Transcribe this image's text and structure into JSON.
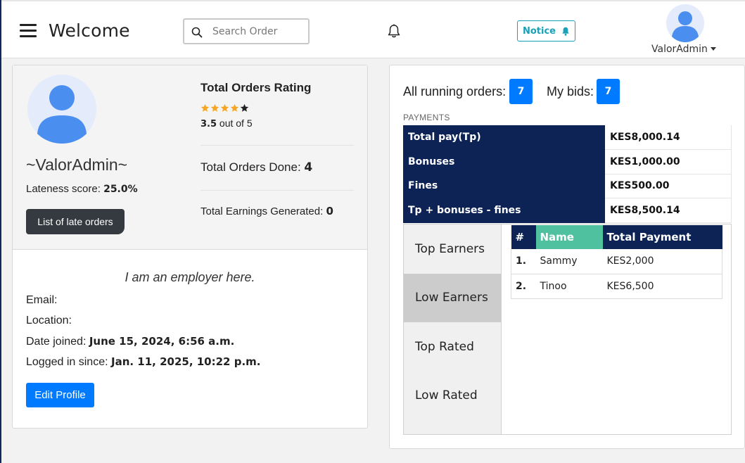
{
  "header": {
    "brand": "Welcome",
    "search_placeholder": "Search Order",
    "notice_label": "Notice",
    "username": "ValorAdmin"
  },
  "profile": {
    "name": "~ValorAdmin~",
    "lateness_label": "Lateness score:",
    "lateness_value": "25.0%",
    "late_orders_button": "List of late orders",
    "rating_title": "Total Orders Rating",
    "rating_value": "3.5",
    "rating_suffix": "out of 5",
    "rating_stars": 3.5,
    "rating_max": 5,
    "orders_done_label": "Total Orders Done:",
    "orders_done_value": "4",
    "earnings_label": "Total Earnings Generated:",
    "earnings_value": "0",
    "tagline": "I am an employer here.",
    "email_label": "Email:",
    "location_label": "Location:",
    "date_joined_label": "Date joined:",
    "date_joined_value": "June 15, 2024, 6:56 a.m.",
    "logged_in_label": "Logged in since:",
    "logged_in_value": "Jan. 11, 2025, 10:22 p.m.",
    "edit_button": "Edit Profile"
  },
  "orders": {
    "running_label": "All running orders:",
    "running_count": "7",
    "bids_label": "My bids:",
    "bids_count": "7"
  },
  "payments": {
    "label": "PAYMENTS",
    "rows": [
      {
        "key": "Total pay(Tp)",
        "value": "KES8,000.14"
      },
      {
        "key": "Bonuses",
        "value": "KES1,000.00"
      },
      {
        "key": "Fines",
        "value": "KES500.00"
      },
      {
        "key": "Tp + bonuses - fines",
        "value": "KES8,500.14"
      }
    ]
  },
  "earners": {
    "tabs": [
      "Top Earners",
      "Low Earners",
      "Top Rated",
      "Low Rated"
    ],
    "active_tab": "Low Earners",
    "columns": [
      "#",
      "Name",
      "Total Payment"
    ],
    "rows": [
      {
        "num": "1.",
        "name": "Sammy",
        "payment": "KES2,000"
      },
      {
        "num": "2.",
        "name": "Tinoo",
        "payment": "KES6,500"
      }
    ]
  },
  "colors": {
    "primary": "#007bff",
    "navy": "#0d2356",
    "teal": "#4fc19e",
    "notice": "#1aa0b8",
    "star": "#f5a623"
  }
}
